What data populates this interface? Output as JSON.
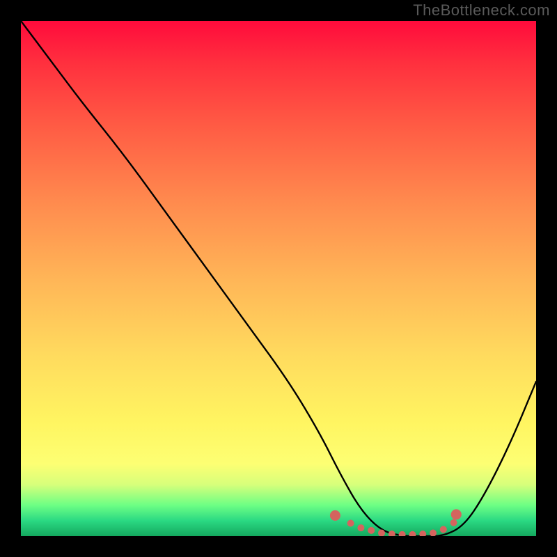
{
  "watermark": "TheBottleneck.com",
  "colors": {
    "background": "#000000",
    "watermark": "#5a5a5a",
    "curve": "#000000",
    "dot": "#d4645e",
    "gradient_stops": [
      "#ff0b3c",
      "#ff2f3e",
      "#ff5a44",
      "#ff8a4e",
      "#ffb557",
      "#ffdb5e",
      "#fff561",
      "#fdff73",
      "#d7ff7b",
      "#6dff84",
      "#2bd983",
      "#14a85e"
    ]
  },
  "chart_data": {
    "type": "line",
    "title": "",
    "xlabel": "",
    "ylabel": "",
    "ylim": [
      0,
      100
    ],
    "xlim": [
      0,
      100
    ],
    "x": [
      0,
      6,
      12,
      20,
      28,
      36,
      44,
      52,
      58,
      62,
      66,
      70,
      74,
      78,
      82,
      86,
      90,
      95,
      100
    ],
    "values": [
      100,
      92,
      84,
      74,
      63,
      52,
      41,
      30,
      20,
      12,
      5,
      1,
      0,
      0,
      0,
      2,
      8,
      18,
      30
    ],
    "valley_markers_x": [
      61,
      64,
      66,
      68,
      70,
      72,
      74,
      76,
      78,
      80,
      82,
      84,
      84.5
    ],
    "valley_markers_y": [
      4,
      2.5,
      1.6,
      1.1,
      0.6,
      0.4,
      0.3,
      0.3,
      0.4,
      0.6,
      1.3,
      2.6,
      4.2
    ]
  }
}
